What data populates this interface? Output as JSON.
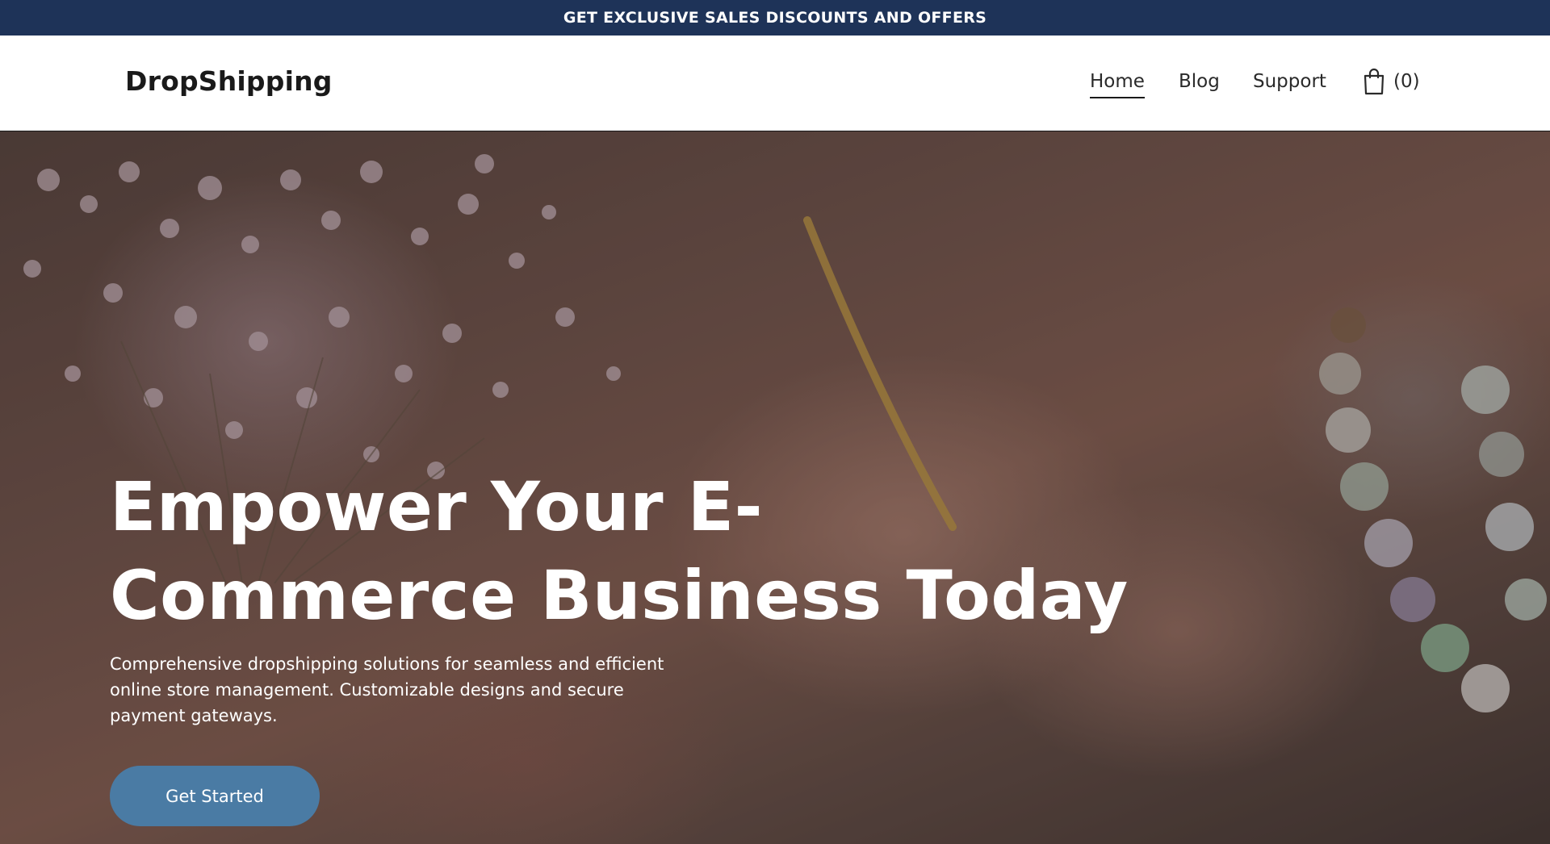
{
  "announcement": {
    "text": "GET EXCLUSIVE SALES DISCOUNTS AND OFFERS"
  },
  "header": {
    "logo": "DropShipping",
    "nav": [
      {
        "label": "Home",
        "active": true
      },
      {
        "label": "Blog",
        "active": false
      },
      {
        "label": "Support",
        "active": false
      }
    ],
    "cart": {
      "icon": "shopping-bag-icon",
      "count_label": "(0)"
    }
  },
  "hero": {
    "title_line1": "Empower Your E-",
    "title_line2": "Commerce Business Today",
    "subtitle": "Comprehensive dropshipping solutions for seamless and efficient online store management. Customizable designs and secure payment gateways.",
    "cta_label": "Get Started"
  },
  "colors": {
    "announcement_bg": "#1e3358",
    "cta_bg": "#4a7ba4",
    "text_dark": "#1a1a1a",
    "text_light": "#ffffff"
  }
}
